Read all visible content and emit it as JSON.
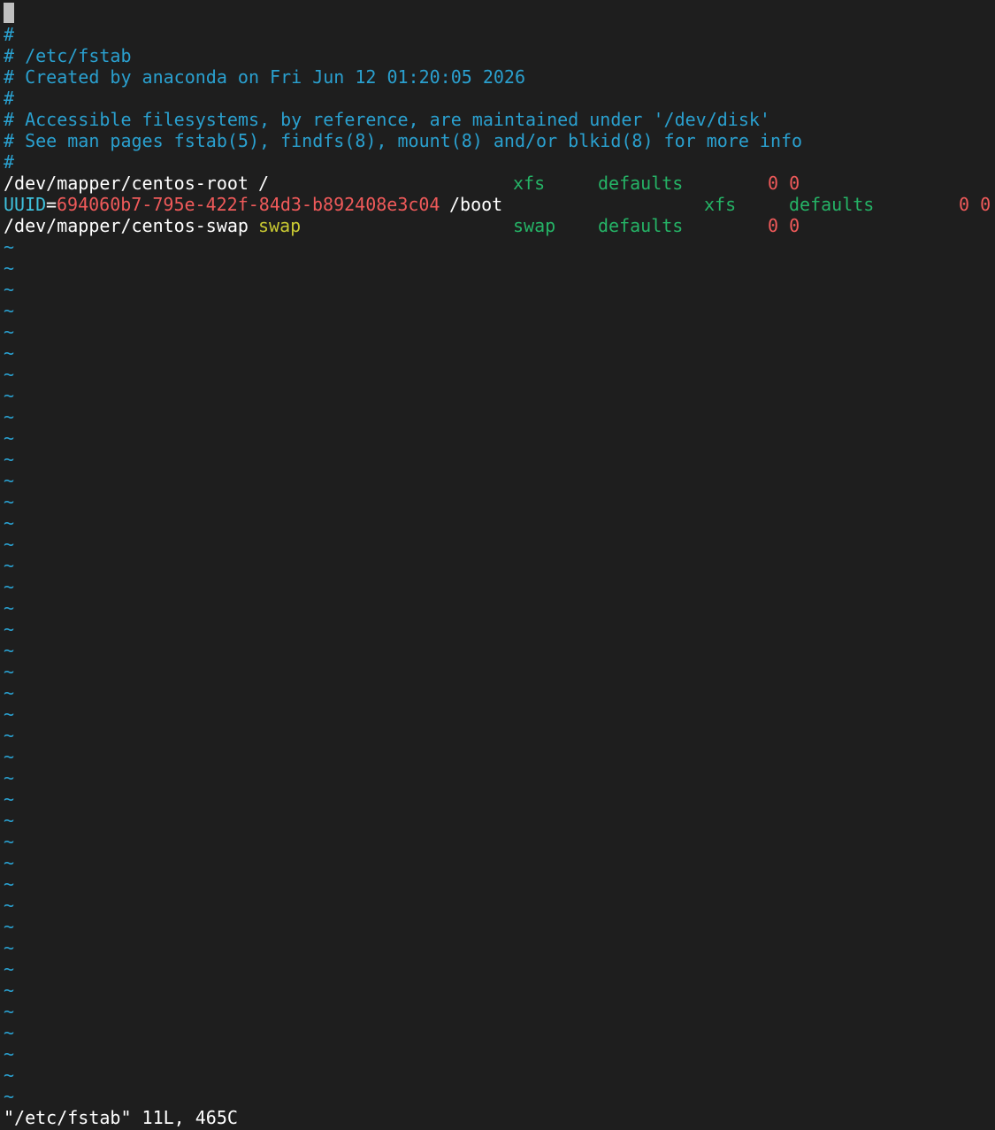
{
  "comments": [
    "#",
    "# /etc/fstab",
    "# Created by anaconda on Fri Jun 12 01:20:05 2026",
    "#",
    "# Accessible filesystems, by reference, are maintained under '/dev/disk'",
    "# See man pages fstab(5), findfs(8), mount(8) and/or blkid(8) for more info",
    "#"
  ],
  "entries": [
    {
      "device": "/dev/mapper/centos-root",
      "mount": "/",
      "fstype": "xfs",
      "options": "defaults",
      "dump_pass": "0 0"
    },
    {
      "uuid_key": "UUID",
      "uuid_eq": "=",
      "uuid_value": "694060b7-795e-422f-84d3-b892408e3c04",
      "mount": "/boot",
      "fstype": "xfs",
      "options": "defaults",
      "dump_pass": "0 0"
    },
    {
      "device": "/dev/mapper/centos-swap",
      "mount": "swap",
      "fstype": "swap",
      "options": "defaults",
      "dump_pass": "0 0"
    }
  ],
  "tilde": "~",
  "tilde_count": 41,
  "status_line": "\"/etc/fstab\" 11L, 465C",
  "colors": {
    "background": "#1e1e1e",
    "comment": "#2aa0cf",
    "uuid_key": "#3ec1dd",
    "number": "#f05a5a",
    "type": "#25b366",
    "swap_keyword": "#c8c832",
    "cursor": "#c0c0c0"
  }
}
